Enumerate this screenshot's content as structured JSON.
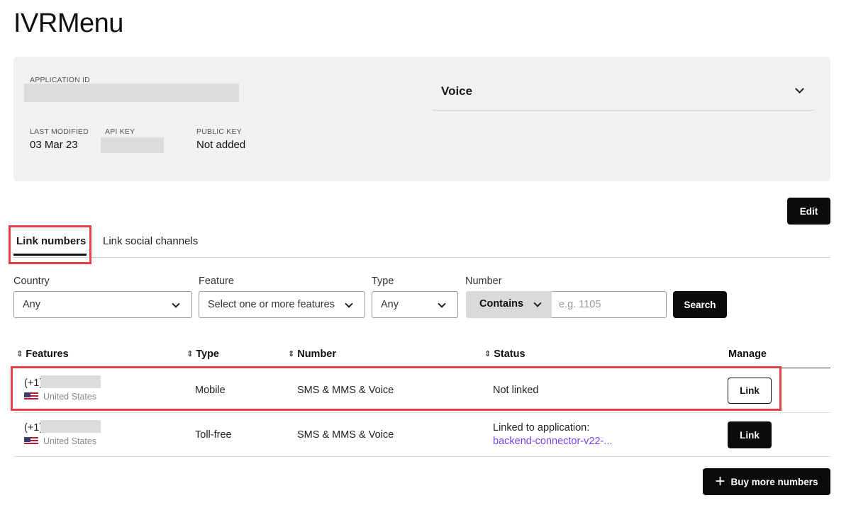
{
  "page": {
    "title": "IVRMenu"
  },
  "app_info": {
    "application_id_label": "APPLICATION ID",
    "last_modified_label": "LAST MODIFIED",
    "last_modified_value": "03 Mar 23",
    "api_key_label": "API KEY",
    "public_key_label": "PUBLIC KEY",
    "public_key_value": "Not added",
    "capability_select": "Voice"
  },
  "actions": {
    "edit_label": "Edit",
    "buy_label": "Buy more numbers"
  },
  "tabs": [
    {
      "label": "Link numbers",
      "active": true
    },
    {
      "label": "Link social channels",
      "active": false
    }
  ],
  "filters": {
    "country_label": "Country",
    "country_value": "Any",
    "feature_label": "Feature",
    "feature_placeholder": "Select one or more features",
    "type_label": "Type",
    "type_value": "Any",
    "number_label": "Number",
    "number_match": "Contains",
    "number_placeholder": "e.g. 1105",
    "search_label": "Search"
  },
  "table": {
    "headers": [
      "Features",
      "Type",
      "Number",
      "Status",
      "Manage"
    ],
    "rows": [
      {
        "number_prefix": "(+1)",
        "country": "United States",
        "type": "Mobile",
        "features": "SMS & MMS & Voice",
        "status": "Not linked",
        "status_link": "",
        "action": "Link"
      },
      {
        "number_prefix": "(+1)",
        "country": "United States",
        "type": "Toll-free",
        "features": "SMS & MMS & Voice",
        "status": "Linked to application:",
        "status_link": "backend-connector-v22-...",
        "action": "Link"
      }
    ]
  },
  "colors": {
    "highlight": "#e8404a",
    "link": "#7b3ff2",
    "primary_button": "#0b0b0b"
  }
}
